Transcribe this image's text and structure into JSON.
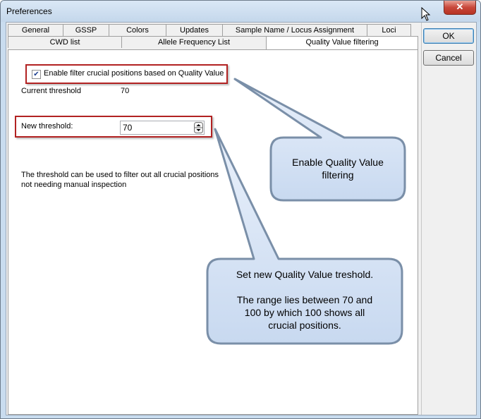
{
  "window": {
    "title": "Preferences",
    "close_label": "✕"
  },
  "tabs_row1": [
    "General",
    "GSSP",
    "Colors",
    "Updates",
    "Sample Name / Locus Assignment",
    "Loci"
  ],
  "tabs_row2": [
    "CWD list",
    "Allele Frequency List",
    "Quality Value filtering"
  ],
  "buttons": {
    "ok": "OK",
    "cancel": "Cancel"
  },
  "filter": {
    "checkbox_label": "Enable filter crucial positions based on Quality Value",
    "checked": true
  },
  "current": {
    "label": "Current threshold",
    "value": "70"
  },
  "new_threshold": {
    "label": "New threshold:",
    "value": "70"
  },
  "description": {
    "line1": "The threshold can be used to filter out all crucial positions",
    "line2": "not needing manual inspection"
  },
  "callout1": {
    "line1": "Enable Quality Value",
    "line2": "filtering"
  },
  "callout2": {
    "line1": "Set new Quality Value treshold.",
    "line2": "The range lies between 70 and",
    "line3": "100 by which 100 shows all",
    "line4": "crucial positions."
  },
  "colors": {
    "callout_fill": "#dce8f8",
    "callout_stroke": "#7a8fa8",
    "highlight_border": "#b22222",
    "window_frame": "#c9dcef"
  }
}
